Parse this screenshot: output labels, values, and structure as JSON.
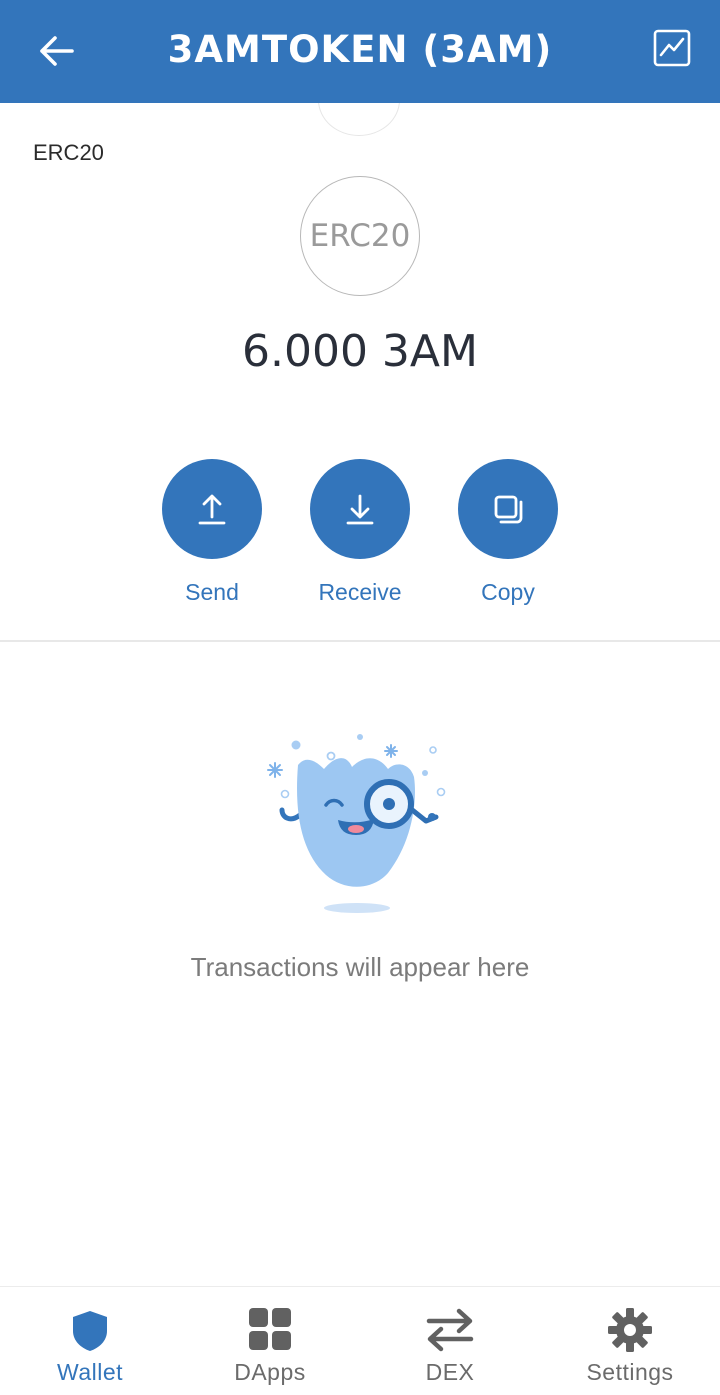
{
  "header": {
    "title": "3AMTOKEN (3AM)",
    "back_icon": "arrow-left-icon",
    "chart_icon": "chart-line-icon"
  },
  "token": {
    "network": "ERC20",
    "logo_text": "ERC20",
    "balance": "6.000 3AM"
  },
  "actions": [
    {
      "label": "Send",
      "icon": "upload-icon"
    },
    {
      "label": "Receive",
      "icon": "download-icon"
    },
    {
      "label": "Copy",
      "icon": "copy-icon"
    }
  ],
  "empty_state": {
    "text": "Transactions will appear here",
    "illustration": "mascot-magnifier-illustration"
  },
  "nav": {
    "items": [
      {
        "label": "Wallet",
        "icon": "shield-icon",
        "active": true
      },
      {
        "label": "DApps",
        "icon": "grid-icon",
        "active": false
      },
      {
        "label": "DEX",
        "icon": "swap-arrows-icon",
        "active": false
      },
      {
        "label": "Settings",
        "icon": "gear-icon",
        "active": false
      }
    ]
  },
  "colors": {
    "primary": "#3375bb",
    "text_dark": "#2a2f3a",
    "text_muted": "#7b7b7b",
    "nav_inactive": "#6b6b6b"
  }
}
